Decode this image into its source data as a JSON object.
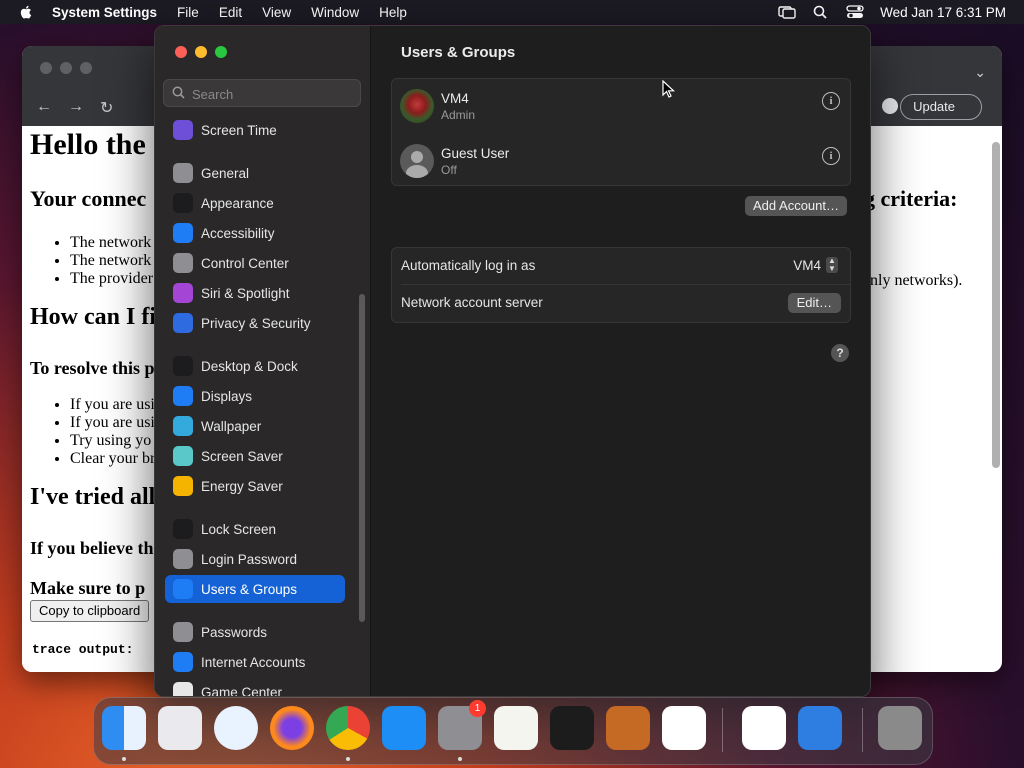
{
  "menubar": {
    "app_name": "System Settings",
    "menus": [
      "File",
      "Edit",
      "View",
      "Window",
      "Help"
    ],
    "clock": "Wed Jan 17  6:31 PM"
  },
  "browser": {
    "update_label": "Update",
    "content": {
      "heading1": "Hello the",
      "heading2a": "Your connec",
      "heading2a_right": "g criteria:",
      "list1": [
        "The network",
        "The network",
        "The provider"
      ],
      "list1_right": "nly networks).",
      "heading2b": "How can I fi",
      "para1": "To resolve this p",
      "list2": [
        "If you are usi",
        "If you are usi",
        "Try using yo",
        "Clear your br"
      ],
      "heading2c": "I've tried all",
      "para2": "If you believe th",
      "para3": "Make sure to p",
      "copy_button": "Copy to clipboard",
      "trace": "trace output:"
    }
  },
  "settings": {
    "search_placeholder": "Search",
    "sidebar": [
      {
        "label": "Screen Time",
        "icon": "hourglass-icon",
        "color": "#6e4fd8"
      },
      {
        "label": "General",
        "icon": "gear-icon",
        "color": "#8e8e93"
      },
      {
        "label": "Appearance",
        "icon": "appearance-icon",
        "color": "#1c1c1e"
      },
      {
        "label": "Accessibility",
        "icon": "accessibility-icon",
        "color": "#1e7cf5"
      },
      {
        "label": "Control Center",
        "icon": "control-center-icon",
        "color": "#8e8e93"
      },
      {
        "label": "Siri & Spotlight",
        "icon": "siri-icon",
        "color": "#a445d6"
      },
      {
        "label": "Privacy & Security",
        "icon": "hand-icon",
        "color": "#2f6be0"
      },
      {
        "label": "Desktop & Dock",
        "icon": "dock-icon",
        "color": "#1c1c1e"
      },
      {
        "label": "Displays",
        "icon": "sun-icon",
        "color": "#1e7cf5"
      },
      {
        "label": "Wallpaper",
        "icon": "flower-icon",
        "color": "#34aadc"
      },
      {
        "label": "Screen Saver",
        "icon": "screen-saver-icon",
        "color": "#5ac8c8"
      },
      {
        "label": "Energy Saver",
        "icon": "bulb-icon",
        "color": "#f4b400"
      },
      {
        "label": "Lock Screen",
        "icon": "lock-icon",
        "color": "#1c1c1e"
      },
      {
        "label": "Login Password",
        "icon": "password-icon",
        "color": "#8e8e93"
      },
      {
        "label": "Users & Groups",
        "icon": "users-icon",
        "color": "#1e7cf5"
      },
      {
        "label": "Passwords",
        "icon": "key-icon",
        "color": "#8e8e93"
      },
      {
        "label": "Internet Accounts",
        "icon": "at-icon",
        "color": "#1e7cf5"
      },
      {
        "label": "Game Center",
        "icon": "game-center-icon",
        "color": "#e8e8e8"
      }
    ],
    "selected": "Users & Groups",
    "main": {
      "title": "Users & Groups",
      "users": [
        {
          "name": "VM4",
          "role": "Admin"
        },
        {
          "name": "Guest User",
          "role": "Off"
        }
      ],
      "add_account": "Add Account…",
      "auto_login_label": "Automatically log in as",
      "auto_login_value": "VM4",
      "network_server_label": "Network account server",
      "edit_label": "Edit…",
      "help_label": "?"
    }
  },
  "dock": {
    "apps": [
      "finder-icon",
      "launchpad-icon",
      "safari-icon",
      "firefox-icon",
      "chrome-icon",
      "app-store-icon",
      "system-settings-icon",
      "textedit-icon",
      "terminal-icon",
      "garageband-icon",
      "vscode-icon",
      "visual-studio-icon",
      "weather-icon",
      "trash-icon"
    ],
    "settings_badge": "1"
  }
}
